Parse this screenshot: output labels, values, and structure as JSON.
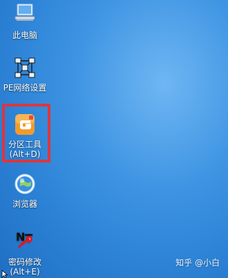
{
  "desktop": {
    "icons": [
      {
        "label": "此电脑",
        "icon": "computer-icon"
      },
      {
        "label": "PE网络设置",
        "icon": "network-icon"
      },
      {
        "label_line1": "分区工具",
        "label_line2": "(Alt+D)",
        "icon": "partition-tool-icon"
      },
      {
        "label": "浏览器",
        "icon": "browser-icon"
      },
      {
        "label_line1": "密码修改",
        "label_line2": "(Alt+E)",
        "icon": "password-change-icon"
      }
    ],
    "highlight_color": "#e0353b"
  },
  "watermark": {
    "text": "知乎 @小白"
  }
}
